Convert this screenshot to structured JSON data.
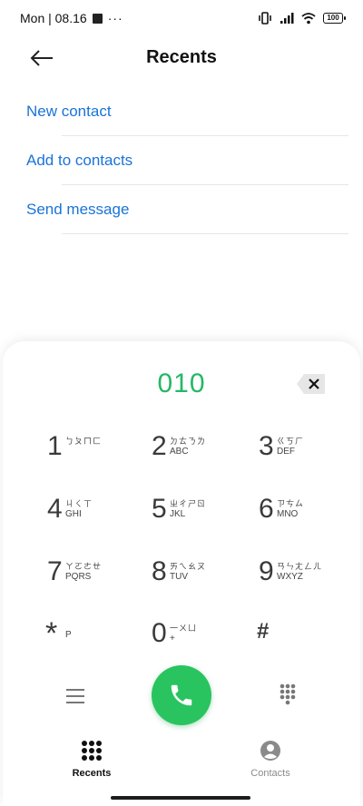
{
  "status_bar": {
    "time": "Mon | 08.16",
    "dots": "···",
    "battery": "100"
  },
  "header": {
    "title": "Recents"
  },
  "actions": [
    {
      "label": "New contact"
    },
    {
      "label": "Add to contacts"
    },
    {
      "label": "Send message"
    }
  ],
  "dialer": {
    "number": "010",
    "keys": [
      {
        "digit": "1",
        "zhuyin": "ㄅㄆㄇㄈ",
        "letters": ""
      },
      {
        "digit": "2",
        "zhuyin": "ㄉㄊㄋㄌ",
        "letters": "ABC"
      },
      {
        "digit": "3",
        "zhuyin": "ㄍㄎㄏ",
        "letters": "DEF"
      },
      {
        "digit": "4",
        "zhuyin": "ㄐㄑㄒ",
        "letters": "GHI"
      },
      {
        "digit": "5",
        "zhuyin": "ㄓㄔㄕㄖ",
        "letters": "JKL"
      },
      {
        "digit": "6",
        "zhuyin": "ㄗㄘㄙ",
        "letters": "MNO"
      },
      {
        "digit": "7",
        "zhuyin": "ㄚㄛㄜㄝ",
        "letters": "PQRS"
      },
      {
        "digit": "8",
        "zhuyin": "ㄞㄟㄠㄡ",
        "letters": "TUV"
      },
      {
        "digit": "9",
        "zhuyin": "ㄢㄣㄤㄥㄦ",
        "letters": "WXYZ"
      },
      {
        "digit": "*",
        "zhuyin": "",
        "letters": "P"
      },
      {
        "digit": "0",
        "zhuyin": "一ㄨㄩ",
        "letters": "+"
      },
      {
        "digit": "#",
        "zhuyin": "",
        "letters": ""
      }
    ]
  },
  "bottom_nav": {
    "recents": "Recents",
    "contacts": "Contacts"
  },
  "colors": {
    "accent_blue": "#1a73d9",
    "dial_green": "#24b866",
    "call_green": "#29c45f"
  },
  "icons": {
    "back": "arrow-left-icon",
    "backspace": "backspace-icon",
    "menu": "menu-icon",
    "call": "phone-icon",
    "dialpad": "dialpad-icon",
    "contacts": "person-icon"
  }
}
